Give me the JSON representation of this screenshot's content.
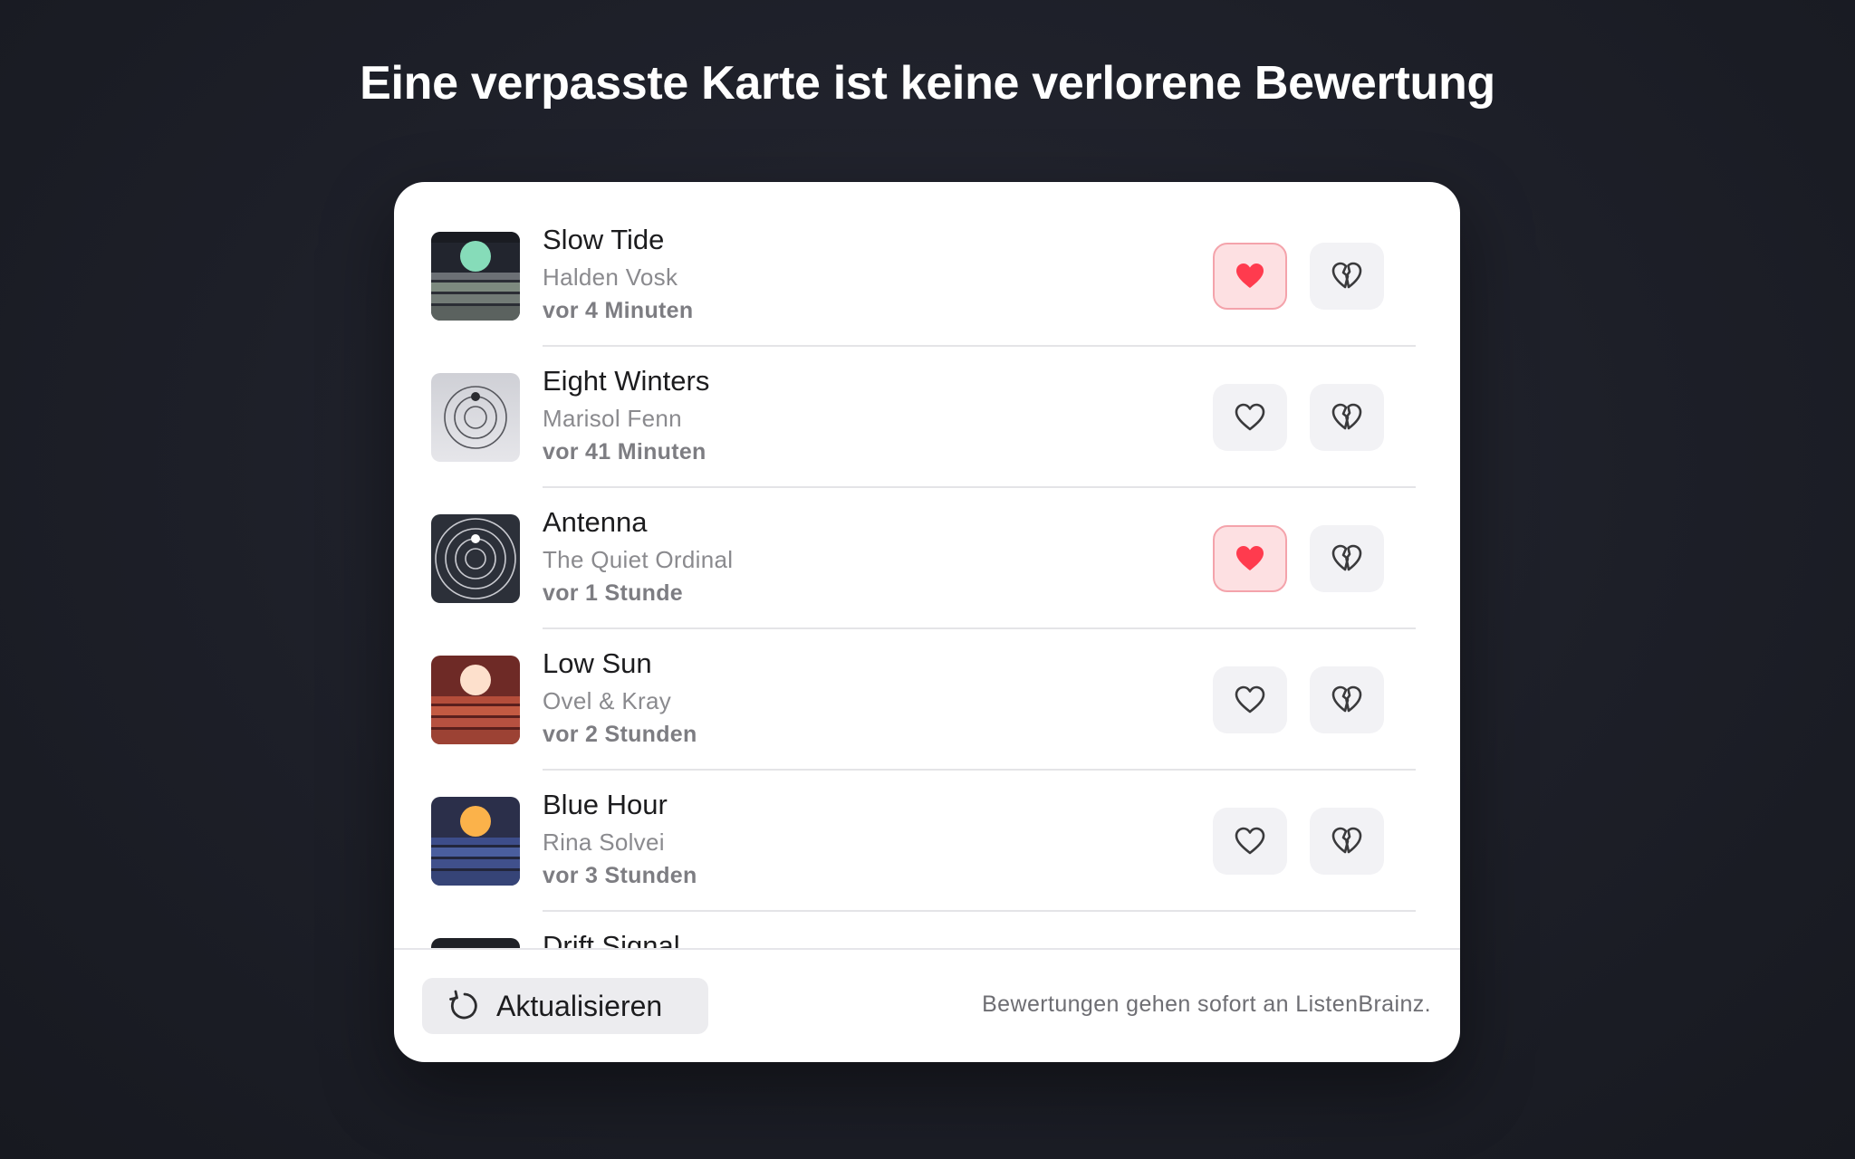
{
  "headline": "Eine verpasste Karte ist keine verlorene Bewertung",
  "tracks": [
    {
      "title": "Slow Tide",
      "artist": "Halden Vosk",
      "time": "vor 4 Minuten",
      "loved": true,
      "cover": "horizon-teal"
    },
    {
      "title": "Eight Winters",
      "artist": "Marisol Fenn",
      "time": "vor 41 Minuten",
      "loved": false,
      "cover": "rings-light"
    },
    {
      "title": "Antenna",
      "artist": "The Quiet Ordinal",
      "time": "vor 1 Stunde",
      "loved": true,
      "cover": "rings-dark"
    },
    {
      "title": "Low Sun",
      "artist": "Ovel & Kray",
      "time": "vor 2 Stunden",
      "loved": false,
      "cover": "horizon-red"
    },
    {
      "title": "Blue Hour",
      "artist": "Rina Solvei",
      "time": "vor 3 Stunden",
      "loved": false,
      "cover": "horizon-blue"
    },
    {
      "title": "Drift Signal",
      "artist": "",
      "time": "",
      "loved": false,
      "cover": "dark"
    }
  ],
  "footer": {
    "refresh_label": "Aktualisieren",
    "note": "Bewertungen gehen sofort an ListenBrainz."
  },
  "colors": {
    "love_active": "#ff3b4e",
    "love_active_bg": "#fde0e2",
    "icon_inactive": "#3a3a3c"
  },
  "icons": {
    "love": "heart-icon",
    "hate": "broken-heart-icon",
    "refresh": "refresh-icon"
  }
}
